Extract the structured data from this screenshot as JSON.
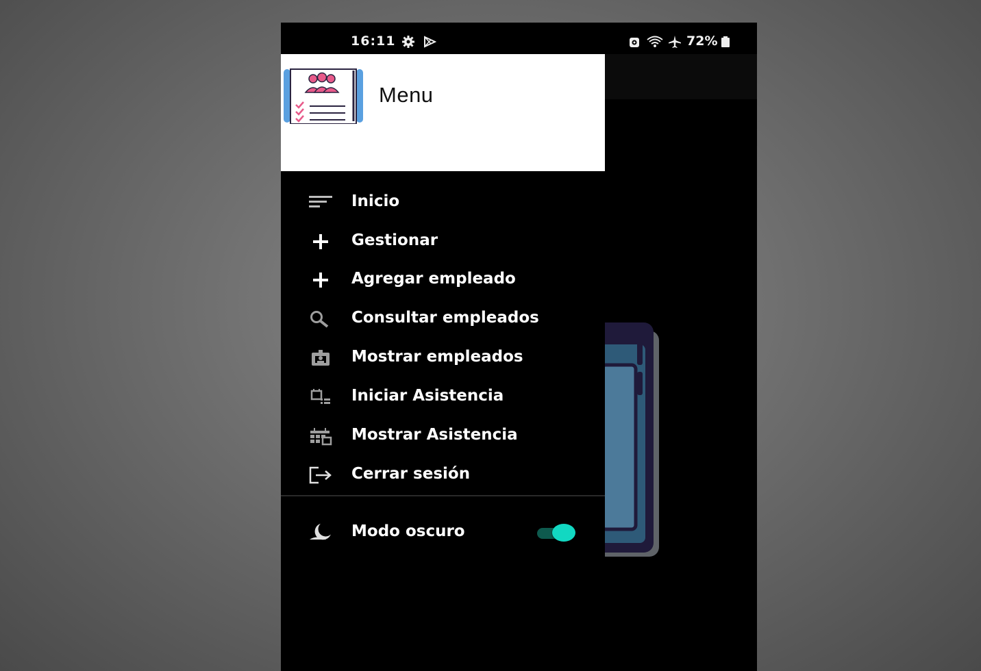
{
  "status_bar": {
    "time": "16:11",
    "battery": "72%",
    "icons": [
      "settings-icon",
      "play-store-icon",
      "alarm-icon",
      "wifi-icon",
      "airplane-icon",
      "battery-icon"
    ]
  },
  "drawer": {
    "title": "Menu",
    "logo_icon": "employee-checklist-logo",
    "items": [
      {
        "label": "Inicio",
        "icon": "sort-lines-icon"
      },
      {
        "label": "Gestionar",
        "icon": "plus-icon"
      },
      {
        "label": "Agregar empleado",
        "icon": "plus-icon"
      },
      {
        "label": "Consultar empleados",
        "icon": "search-icon"
      },
      {
        "label": "Mostrar empleados",
        "icon": "badge-icon"
      },
      {
        "label": "Iniciar Asistencia",
        "icon": "schedule-list-icon"
      },
      {
        "label": "Mostrar Asistencia",
        "icon": "calendar-grid-icon"
      },
      {
        "label": "Cerrar sesión",
        "icon": "logout-icon"
      }
    ],
    "dark_mode": {
      "label": "Modo oscuro",
      "icon": "moon-icon",
      "enabled": true
    }
  },
  "colors": {
    "drawer_background": "#000000",
    "header_background": "#ffffff",
    "toggle_thumb": "#12d8c2",
    "toggle_track": "#0e5a4e",
    "logo_accent": "#e85a8a",
    "logo_blue": "#5aa0e0"
  }
}
